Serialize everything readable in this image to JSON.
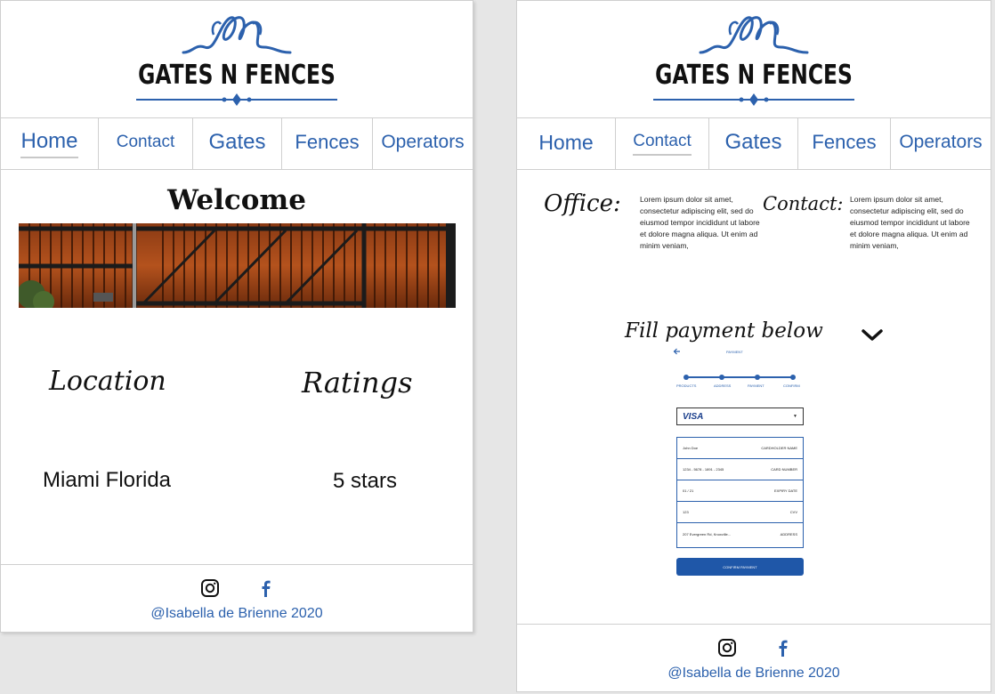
{
  "brand": {
    "name": "GATES N FENCES",
    "accent": "#2c61ad"
  },
  "nav": {
    "home": "Home",
    "contact": "Contact",
    "gates": "Gates",
    "fences": "Fences",
    "operators": "Operators"
  },
  "home_page": {
    "title": "Welcome",
    "location_heading": "Location",
    "ratings_heading": "Ratings",
    "location_value": "Miami Florida",
    "ratings_value": "5 stars"
  },
  "contact_page": {
    "office_heading": "Office:",
    "contact_heading": "Contact:",
    "office_text": "Lorem ipsum dolor sit amet, consectetur adipiscing elit, sed do eiusmod tempor incididunt ut labore et dolore magna aliqua. Ut enim ad minim veniam,",
    "contact_text": "Lorem ipsum dolor sit amet, consectetur adipiscing elit, sed do eiusmod tempor incididunt ut labore et dolore magna aliqua. Ut enim ad minim veniam,",
    "payment_heading": "Fill payment below",
    "payment": {
      "header": "PAYMENT",
      "card_brand": "VISA",
      "steps": [
        "PRODUCTS",
        "ADDRESS",
        "PAYMENT",
        "CONFIRM"
      ],
      "fields": [
        {
          "value": "John Doe",
          "label": "CARDHOLDER NAME"
        },
        {
          "value": "1234 - 5678 - 1891 - 2345",
          "label": "CARD NUMBER"
        },
        {
          "value": "01 / 21",
          "label": "EXPIRY DATE"
        },
        {
          "value": "123",
          "label": "CVV"
        },
        {
          "value": "207 Evergreen Rd, Knoxville...",
          "label": "ADDRESS"
        }
      ],
      "button": "CONFIRM PAYMENT"
    }
  },
  "footer": {
    "credit": "@Isabella de Brienne 2020"
  },
  "icons": {
    "social_1": "instagram-icon",
    "social_2": "facebook-icon",
    "dropdown": "chevron-down-icon"
  }
}
